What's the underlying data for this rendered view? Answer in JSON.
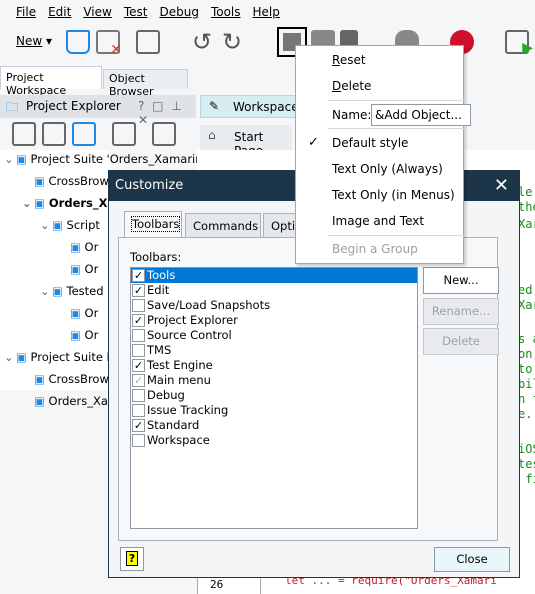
{
  "menubar": [
    "File",
    "Edit",
    "View",
    "Test",
    "Debug",
    "Tools",
    "Help"
  ],
  "toolbar": {
    "new_label": "New"
  },
  "panel_tabs": [
    "Project Workspace",
    "Object Browser"
  ],
  "project_explorer": {
    "title": "Project Explorer",
    "controls": "? □ ⊥ ✕"
  },
  "workspace": {
    "title": "Workspace",
    "start_page": "Start Page"
  },
  "tree": [
    {
      "label": "Project Suite 'Orders_Xamarin.Fo",
      "indent": 0,
      "toggle": "⌄"
    },
    {
      "label": "CrossBrow",
      "indent": 1
    },
    {
      "label": "Orders_X",
      "indent": 1,
      "toggle": "⌄",
      "bold": true
    },
    {
      "label": "Script",
      "indent": 2,
      "toggle": "⌄"
    },
    {
      "label": "Or",
      "indent": 3
    },
    {
      "label": "Or",
      "indent": 3
    },
    {
      "label": "Tested",
      "indent": 2,
      "toggle": "⌄"
    },
    {
      "label": "Or",
      "indent": 3
    },
    {
      "label": "Or",
      "indent": 3
    },
    {
      "label": "Project Suite L",
      "indent": 0,
      "toggle": "⌄"
    },
    {
      "label": "CrossBrow",
      "indent": 1
    },
    {
      "label": "Orders_Xa",
      "indent": 1
    }
  ],
  "code_fragments": [
    [
      "le",
      193
    ],
    [
      "the",
      208
    ],
    [
      "Xar",
      225
    ],
    [
      "ed",
      291
    ],
    [
      "Xar",
      306
    ],
    [
      "s a",
      340
    ],
    [
      "on",
      355
    ],
    [
      "to",
      370
    ],
    [
      "bil",
      385
    ],
    [
      "n f",
      400
    ],
    [
      "e.",
      415
    ],
    [
      "iOS",
      450
    ],
    [
      "tes",
      465
    ],
    " fi"
  ],
  "code_lines": {
    "a": "le",
    "b": "the",
    "c": "Xar",
    "d": "ed",
    "e": "Xar",
    "f": "s a",
    "g": "on",
    "h": "to",
    "i": "bil",
    "j": "n f",
    "k": "e.",
    "l": "iOS",
    "m": "tes",
    "n": " fi"
  },
  "bottom_code": {
    "line_25": "25",
    "line_26": "26",
    "text": "let ... = require(\"Orders_Xamari"
  },
  "dialog": {
    "title": "Customize",
    "tabs": [
      "Toolbars",
      "Commands",
      "Optio"
    ],
    "list_label": "Toolbars:",
    "toolbars": [
      {
        "label": "Tools",
        "checked": true,
        "selected": true
      },
      {
        "label": "Edit",
        "checked": true
      },
      {
        "label": "Save/Load Snapshots",
        "checked": false
      },
      {
        "label": "Project Explorer",
        "checked": true
      },
      {
        "label": "Source Control",
        "checked": false
      },
      {
        "label": "TMS",
        "checked": false
      },
      {
        "label": "Test Engine",
        "checked": true
      },
      {
        "label": "Main menu",
        "checked": true,
        "disabled": true
      },
      {
        "label": "Debug",
        "checked": false
      },
      {
        "label": "Issue Tracking",
        "checked": false
      },
      {
        "label": "Standard",
        "checked": true
      },
      {
        "label": "Workspace",
        "checked": false
      }
    ],
    "buttons": {
      "new": "New...",
      "rename": "Rename...",
      "delete": "Delete",
      "close": "Close",
      "help": "?"
    }
  },
  "context_menu": {
    "reset": "Reset",
    "delete": "Delete",
    "name_label": "Name:",
    "name_value": "&Add Object...",
    "default_style": "Default style",
    "text_only_always": "Text Only (Always)",
    "text_only_menus": "Text Only (in Menus)",
    "image_and_text": "Image and Text",
    "begin_group": "Begin a Group"
  },
  "colors": {
    "dialog_title": "#1c3548",
    "selection": "#0078d7",
    "code_green": "#1a8a1a"
  }
}
